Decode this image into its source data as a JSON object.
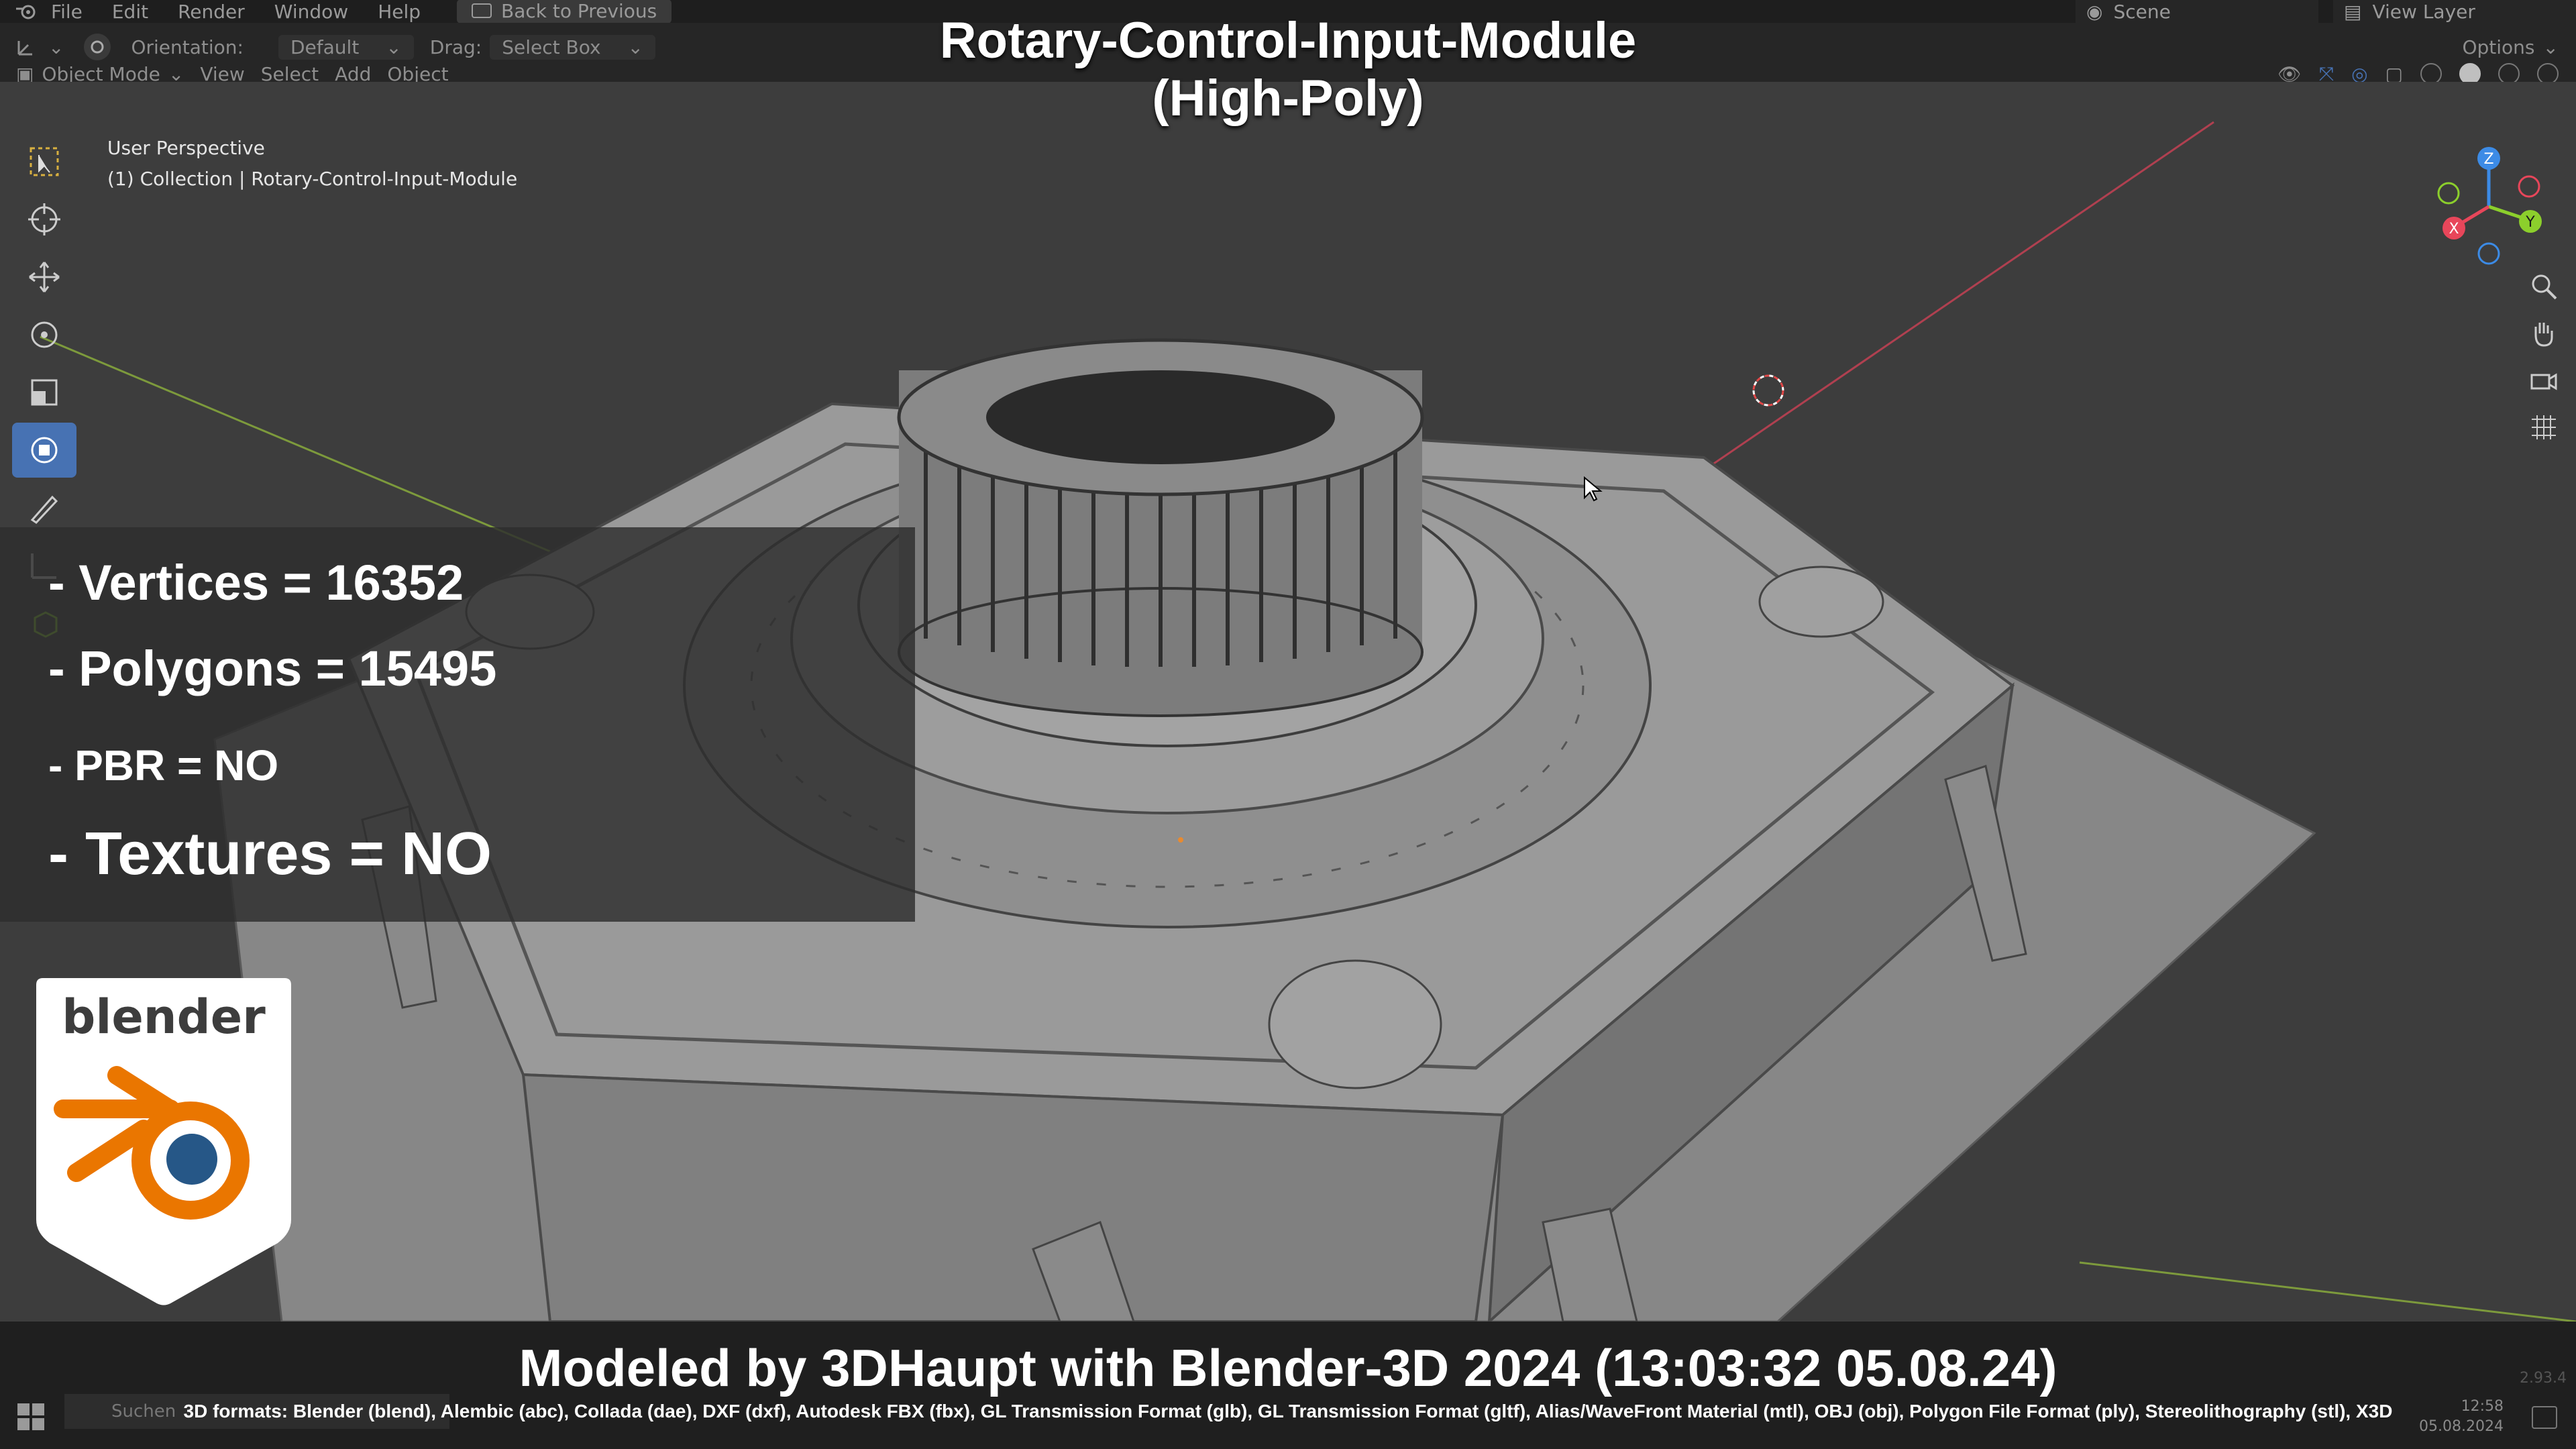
{
  "title": {
    "line1": "Rotary-Control-Input-Module",
    "line2": "(High-Poly)"
  },
  "menu": {
    "items": [
      "File",
      "Edit",
      "Render",
      "Window",
      "Help"
    ],
    "back_button": "Back to Previous",
    "scene": "Scene",
    "view_layer": "View Layer"
  },
  "toolbar": {
    "orientation_label": "Orientation:",
    "orientation_value": "Default",
    "drag_label": "Drag:",
    "drag_value": "Select Box",
    "options": "Options",
    "mode": "Object Mode",
    "view": "View",
    "select": "Select",
    "add": "Add",
    "object": "Object"
  },
  "viewport": {
    "perspective": "User Perspective",
    "collection": "(1) Collection | Rotary-Control-Input-Module"
  },
  "gizmo": {
    "z": "Z",
    "x": "X",
    "y": "Y"
  },
  "stats": {
    "vertices": "- Vertices = 16352",
    "polygons": "- Polygons = 15495",
    "pbr": "- PBR =  NO",
    "textures": "- Textures = NO"
  },
  "badge": {
    "text": "blender"
  },
  "banner": {
    "credit": "Modeled by 3DHaupt with Blender-3D 2024 (13:03:32  05.08.24)",
    "formats": "3D formats: Blender (blend), Alembic (abc), Collada (dae), DXF (dxf), Autodesk FBX (fbx), GL Transmission Format (glb), GL Transmission Format (gltf), Alias/WaveFront Material (mtl), OBJ (obj), Polygon File Format (ply), Stereolithography (stl), X3D"
  },
  "taskbar": {
    "search": "Suchen",
    "time": "12:58",
    "date": "05.08.2024",
    "version": "2.93.4"
  },
  "colors": {
    "accent": "#4772b3",
    "blender_orange": "#ea7600",
    "blender_blue": "#265787",
    "axis_x": "#e8465a",
    "axis_y": "#8ccf2c",
    "axis_z": "#3c8be6"
  }
}
